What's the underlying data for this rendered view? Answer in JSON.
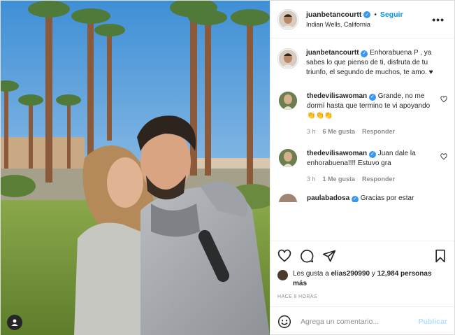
{
  "photo": {
    "user_tag_icon": "person-icon",
    "sky_top": "#3f8fd6",
    "sky_bottom": "#bcd8ee",
    "grass": "#7a9a3a"
  },
  "header": {
    "username": "juanbetancourtt",
    "separator": "•",
    "follow_label": "Seguir",
    "location": "Indian Wells, California",
    "more_icon": "more-horizontal-icon",
    "more_label": "•••"
  },
  "caption": {
    "username": "juanbetancourtt",
    "text": "Enhorabuena P , ya sabes lo que pienso de ti, disfruta de tu triunfo, el segundo de muchos, te amo. ♥"
  },
  "comments": [
    {
      "username": "thedevilisawoman",
      "text": "Grande, no me dormí hasta que termino te vi apoyando 👏👏👏",
      "time": "3 h",
      "likes": "6 Me gusta",
      "reply": "Responder"
    },
    {
      "username": "thedevilisawoman",
      "text": "Juan dale la enhorabuena!!!! Estuvo gra",
      "time": "3 h",
      "likes": "1 Me gusta",
      "reply": "Responder"
    },
    {
      "username": "paulabadosa",
      "text": "Gracias por estar"
    }
  ],
  "actions": {
    "like_icon": "heart-icon",
    "comment_icon": "comment-icon",
    "share_icon": "paper-plane-icon",
    "save_icon": "bookmark-icon",
    "likes_prefix": "Les gusta a ",
    "likes_user": "elias290990",
    "likes_mid": " y ",
    "likes_count": "12,984 personas más",
    "time_ago": "HACE 8 HORAS"
  },
  "add_comment": {
    "emoji_icon": "emoji-icon",
    "placeholder": "Agrega un comentario...",
    "publish_label": "Publicar"
  },
  "colors": {
    "accent": "#0095f6",
    "verified": "#3897f0",
    "muted": "#8e8e8e",
    "publish_disabled": "#b2dffc"
  }
}
